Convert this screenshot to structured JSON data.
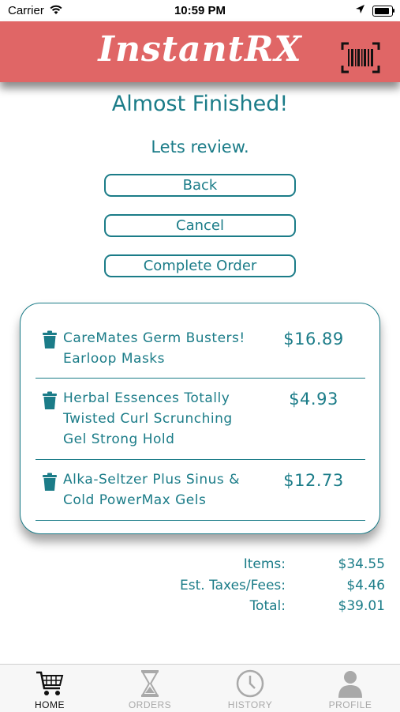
{
  "status_bar": {
    "carrier": "Carrier",
    "time": "10:59 PM"
  },
  "header": {
    "brand": "InstantRX",
    "scan_icon": "barcode-scan-icon"
  },
  "page": {
    "title": "Almost Finished!",
    "subtitle": "Lets review."
  },
  "actions": {
    "back_label": "Back",
    "cancel_label": "Cancel",
    "complete_label": "Complete Order"
  },
  "cart": {
    "items": [
      {
        "name": "CareMates Germ Busters! Earloop Masks",
        "price": "$16.89"
      },
      {
        "name": "Herbal Essences Totally Twisted Curl Scrunching Gel Strong Hold",
        "price": "$4.93"
      },
      {
        "name": "Alka-Seltzer Plus Sinus & Cold PowerMax Gels",
        "price": "$12.73"
      }
    ]
  },
  "totals": {
    "items_label": "Items:",
    "items_value": "$34.55",
    "taxes_label": "Est. Taxes/Fees:",
    "taxes_value": "$4.46",
    "total_label": "Total:",
    "total_value": "$39.01"
  },
  "tabs": [
    {
      "label": "HOME",
      "icon": "cart-icon",
      "active": true
    },
    {
      "label": "ORDERS",
      "icon": "hourglass-icon",
      "active": false
    },
    {
      "label": "HISTORY",
      "icon": "clock-icon",
      "active": false
    },
    {
      "label": "PROFILE",
      "icon": "person-icon",
      "active": false
    }
  ],
  "colors": {
    "accent": "#1b7c88",
    "header": "#e06666",
    "tab_inactive": "#a9a9a9"
  }
}
